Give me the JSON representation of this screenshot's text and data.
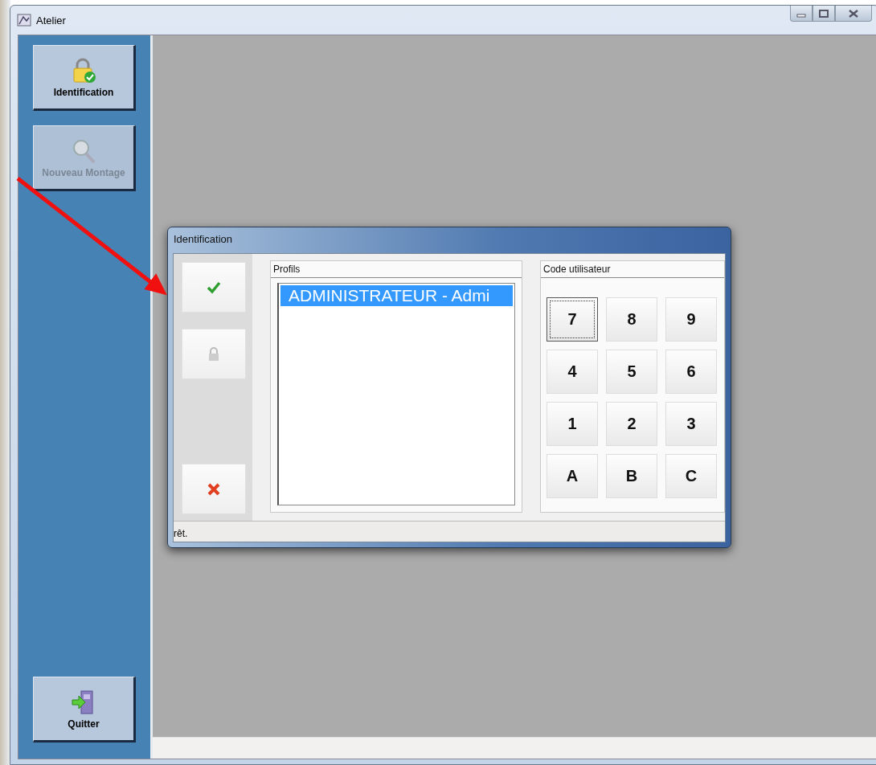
{
  "window": {
    "title": "Atelier"
  },
  "sidebar": {
    "buttons": [
      {
        "label": "Identification",
        "kind": "lock",
        "disabled": false
      },
      {
        "label": "Nouveau Montage",
        "kind": "search",
        "disabled": true
      }
    ],
    "bottom_button": {
      "label": "Quitter",
      "kind": "exit",
      "disabled": false
    }
  },
  "dialog": {
    "title": "Identification",
    "actions": [
      {
        "kind": "ok"
      },
      {
        "kind": "lock"
      },
      {
        "kind": "cancel"
      }
    ],
    "profiles": {
      "title": "Profils",
      "items": [
        {
          "label": "ADMINISTRATEUR - Admi",
          "selected": true
        }
      ]
    },
    "keypad": {
      "title": "Code utilisateur",
      "keys": [
        {
          "label": "7",
          "focused": true
        },
        {
          "label": "8",
          "focused": false
        },
        {
          "label": "9",
          "focused": false
        },
        {
          "label": "4",
          "focused": false
        },
        {
          "label": "5",
          "focused": false
        },
        {
          "label": "6",
          "focused": false
        },
        {
          "label": "1",
          "focused": false
        },
        {
          "label": "2",
          "focused": false
        },
        {
          "label": "3",
          "focused": false
        },
        {
          "label": "A",
          "focused": false
        },
        {
          "label": "B",
          "focused": false
        },
        {
          "label": "C",
          "focused": false
        }
      ]
    },
    "status_bar": "rêt."
  },
  "annotation": {
    "kind": "arrow"
  }
}
